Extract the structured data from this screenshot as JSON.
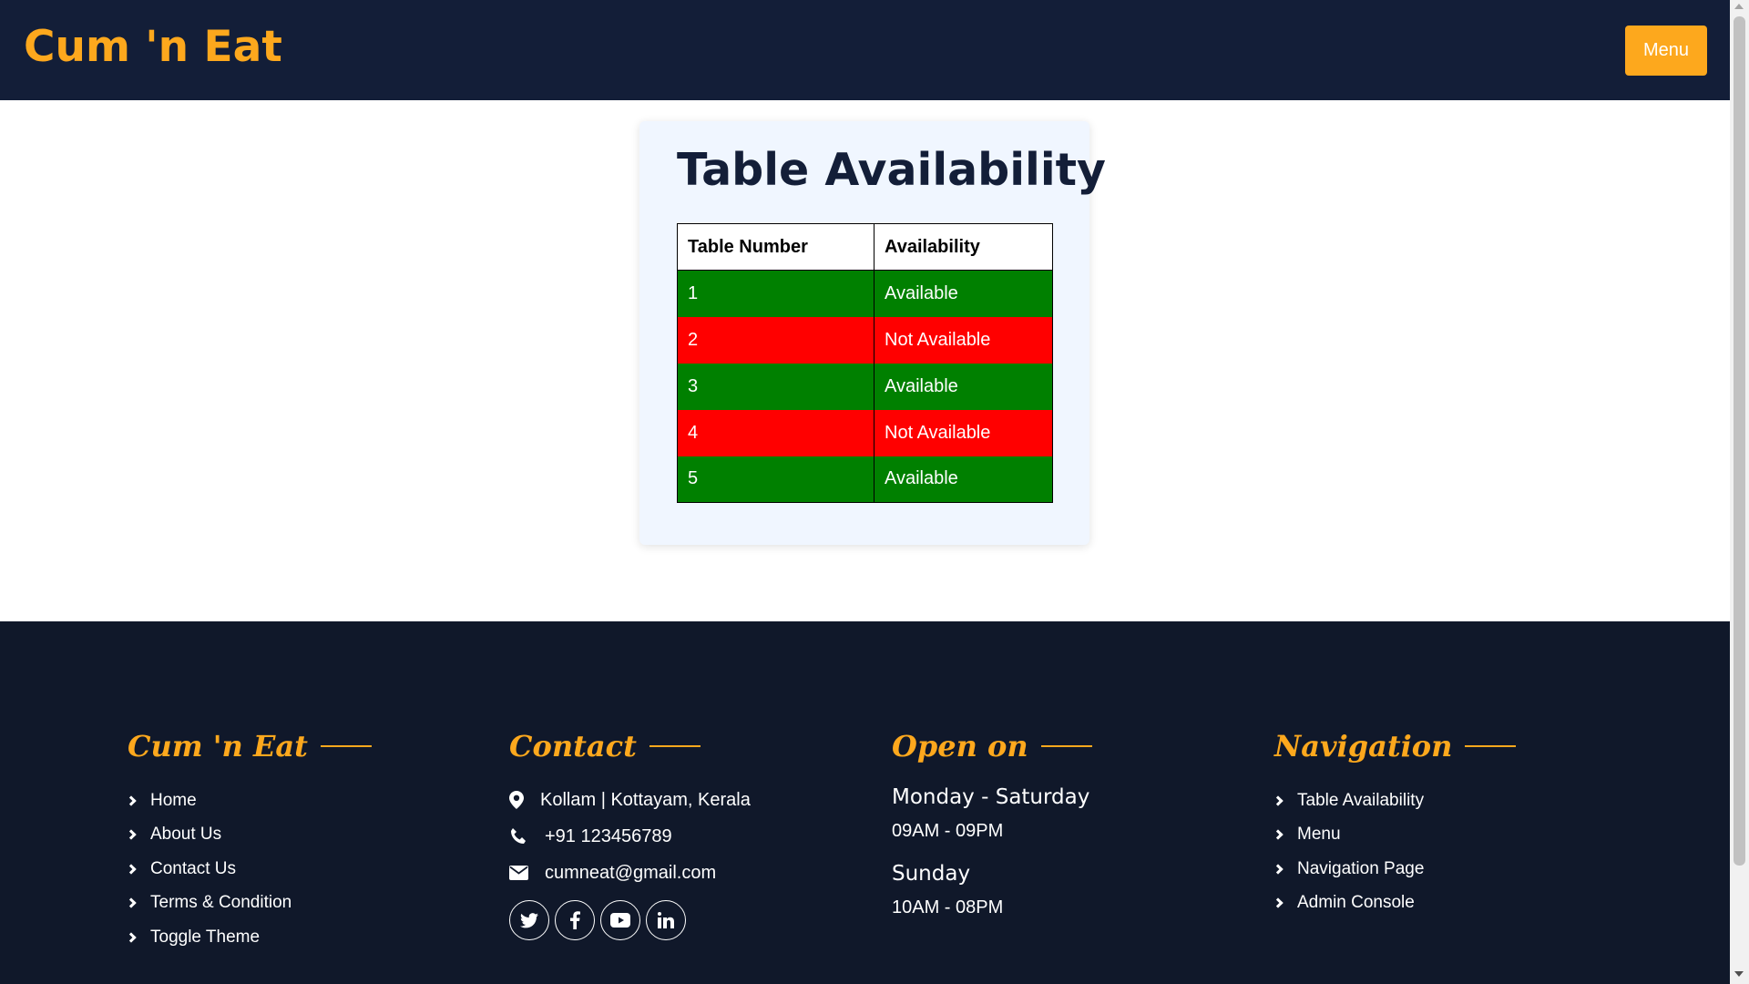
{
  "header": {
    "brand": "Cum 'n Eat",
    "menu_button": "Menu"
  },
  "availability": {
    "title": "Table Availability",
    "columns": [
      "Table Number",
      "Availability"
    ],
    "rows": [
      {
        "table": "1",
        "status": "Available",
        "color": "#008000"
      },
      {
        "table": "2",
        "status": "Not Available",
        "color": "#ff0000"
      },
      {
        "table": "3",
        "status": "Available",
        "color": "#008000"
      },
      {
        "table": "4",
        "status": "Not Available",
        "color": "#ff0000"
      },
      {
        "table": "5",
        "status": "Available",
        "color": "#008000"
      }
    ]
  },
  "footer": {
    "brand": {
      "title": "Cum 'n Eat",
      "links": [
        "Home",
        "About Us",
        "Contact Us",
        "Terms & Condition",
        "Toggle Theme"
      ]
    },
    "contact": {
      "title": "Contact",
      "address": "Kollam | Kottayam, Kerala",
      "phone": "+91 123456789",
      "email": "cumneat@gmail.com",
      "socials": [
        "twitter-icon",
        "facebook-icon",
        "youtube-icon",
        "linkedin-icon"
      ]
    },
    "open": {
      "title": "Open on",
      "weekday_label": "Monday - Saturday",
      "weekday_hours": "09AM - 09PM",
      "sunday_label": "Sunday",
      "sunday_hours": "10AM - 08PM"
    },
    "navigation": {
      "title": "Navigation",
      "links": [
        "Table Availability",
        "Menu",
        "Navigation Page",
        "Admin Console"
      ]
    }
  },
  "colors": {
    "navy": "#131e38",
    "accent": "#fda81d",
    "available": "#008000",
    "not_available": "#ff0000"
  }
}
